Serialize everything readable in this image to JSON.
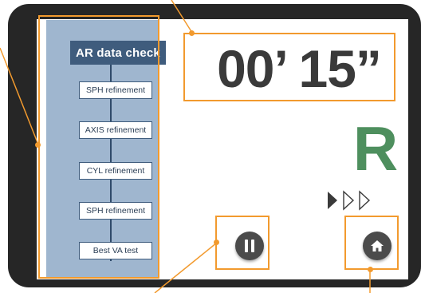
{
  "flow": {
    "title": "AR data check",
    "steps": [
      {
        "label": "SPH refinement"
      },
      {
        "label": "AXIS refinement"
      },
      {
        "label": "CYL refinement"
      },
      {
        "label": "SPH refinement"
      },
      {
        "label": "Best VA test"
      }
    ]
  },
  "timer": {
    "text": "00’ 15”"
  },
  "optotype": {
    "letter": "R",
    "color": "#4e8f5e"
  },
  "progress": {
    "current": 1,
    "total": 3
  },
  "controls": {
    "pause_icon": "pause-icon",
    "home_icon": "home-icon"
  },
  "colors": {
    "highlight": "#f29a2e",
    "panel": "#9fb6cf",
    "title_bg": "#3f5c7d",
    "button": "#4b4b4b",
    "bezel": "#262626"
  }
}
